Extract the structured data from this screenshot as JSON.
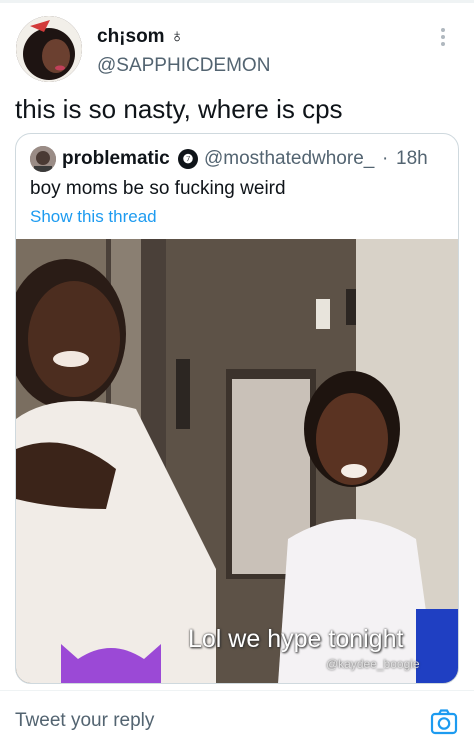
{
  "tweet": {
    "author_name": "ch¡som ♁",
    "author_handle": "@SAPPHICDEMON",
    "text": "this is so nasty, where is cps",
    "more_icon": "more-vertical-icon"
  },
  "quoted_tweet": {
    "author_name": "problematic",
    "verified_badge": "❼",
    "author_handle": "@mosthatedwhore_",
    "separator": "·",
    "time": "18h",
    "text": "boy moms be so fucking weird",
    "show_thread": "Show this thread",
    "video": {
      "caption": "Lol we hype tonight",
      "watermark": "@kaydee_boogie"
    }
  },
  "reply": {
    "placeholder": "Tweet your reply",
    "camera_icon": "camera-icon"
  },
  "colors": {
    "link": "#1d9bf0",
    "secondary_text": "#536471",
    "border": "#cfd9de"
  }
}
